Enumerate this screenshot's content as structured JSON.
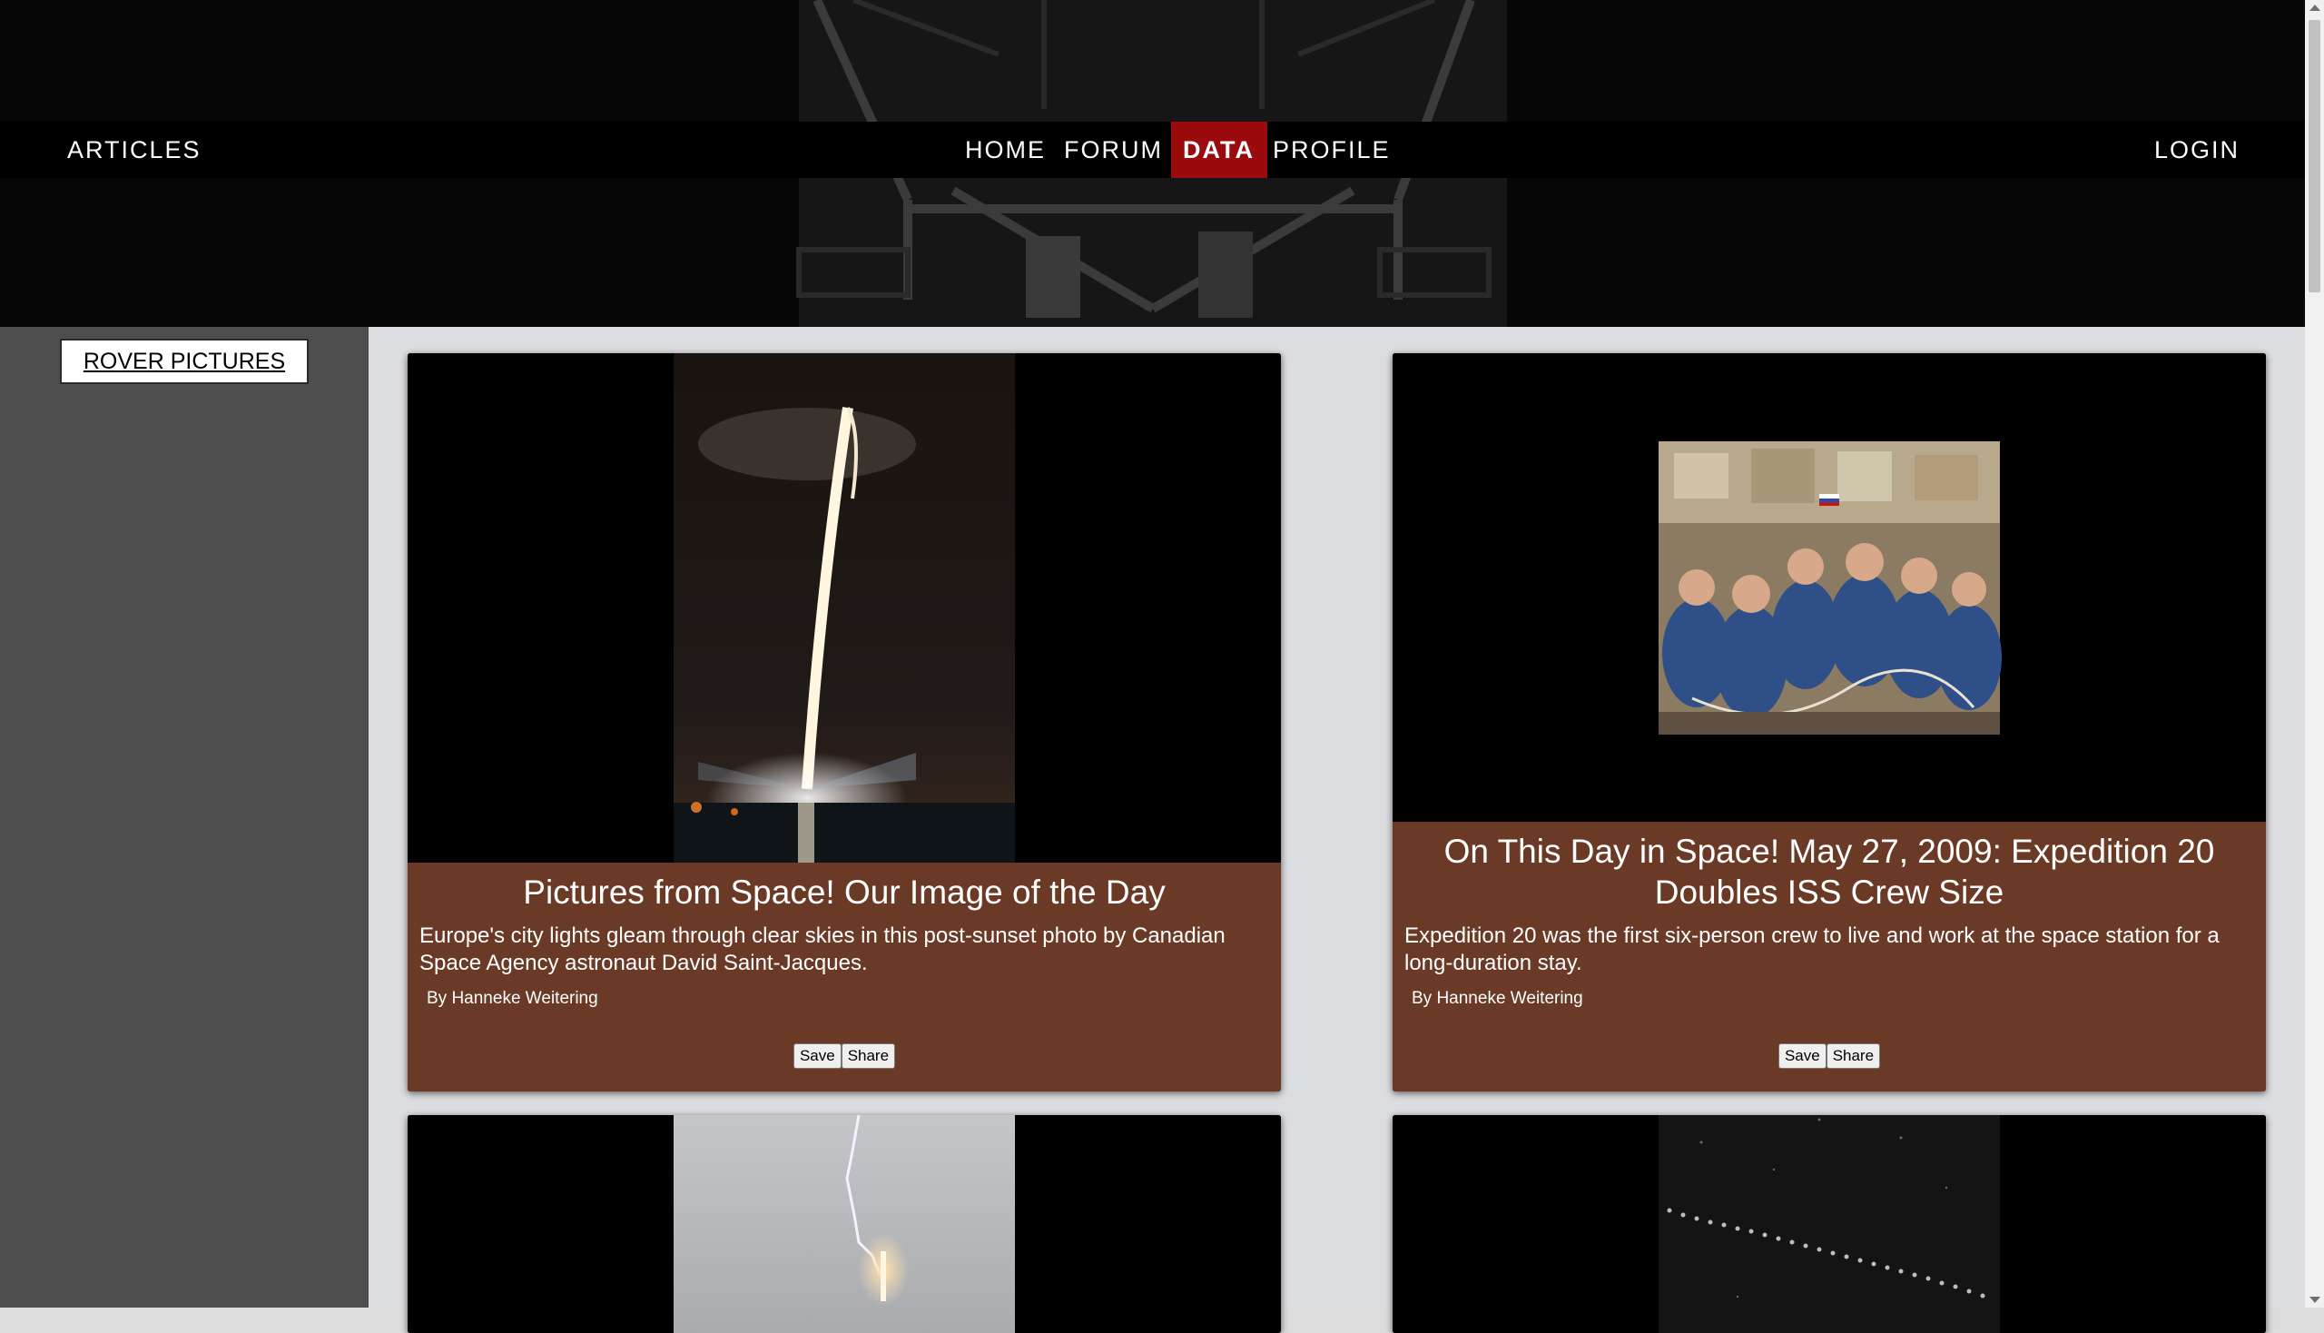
{
  "nav": {
    "articles": "ARTICLES",
    "home": "HOME",
    "forum": "FORUM",
    "data": "DATA",
    "profile": "PROFILE",
    "login": "LOGIN",
    "active_item": "DATA",
    "active_color": "#9b0a0d"
  },
  "sidebar": {
    "rover_pictures": "ROVER PICTURES"
  },
  "cards": [
    {
      "title": "Pictures from Space! Our Image of the Day",
      "description": "Europe's city lights gleam through clear skies in this post-sunset photo by Canadian Space Agency astronaut David Saint-Jacques.",
      "byline": "By Hanneke Weitering",
      "save": "Save",
      "share": "Share",
      "image": "night-rocket-launch"
    },
    {
      "title": "On This Day in Space! May 27, 2009: Expedition 20 Doubles ISS Crew Size",
      "description": "Expedition 20 was the first six-person crew to live and work at the space station for a long-duration stay.",
      "byline": "By Hanneke Weitering",
      "save": "Save",
      "share": "Share",
      "image": "iss-crew-photo"
    },
    {
      "image": "lightning-rocket-launch"
    },
    {
      "image": "satellite-trail-night-sky"
    }
  ],
  "colors": {
    "card_body": "#6b3a27",
    "sidebar": "#4e4e4e",
    "main_bg": "#dcdde0",
    "header_bg": "#000000"
  }
}
